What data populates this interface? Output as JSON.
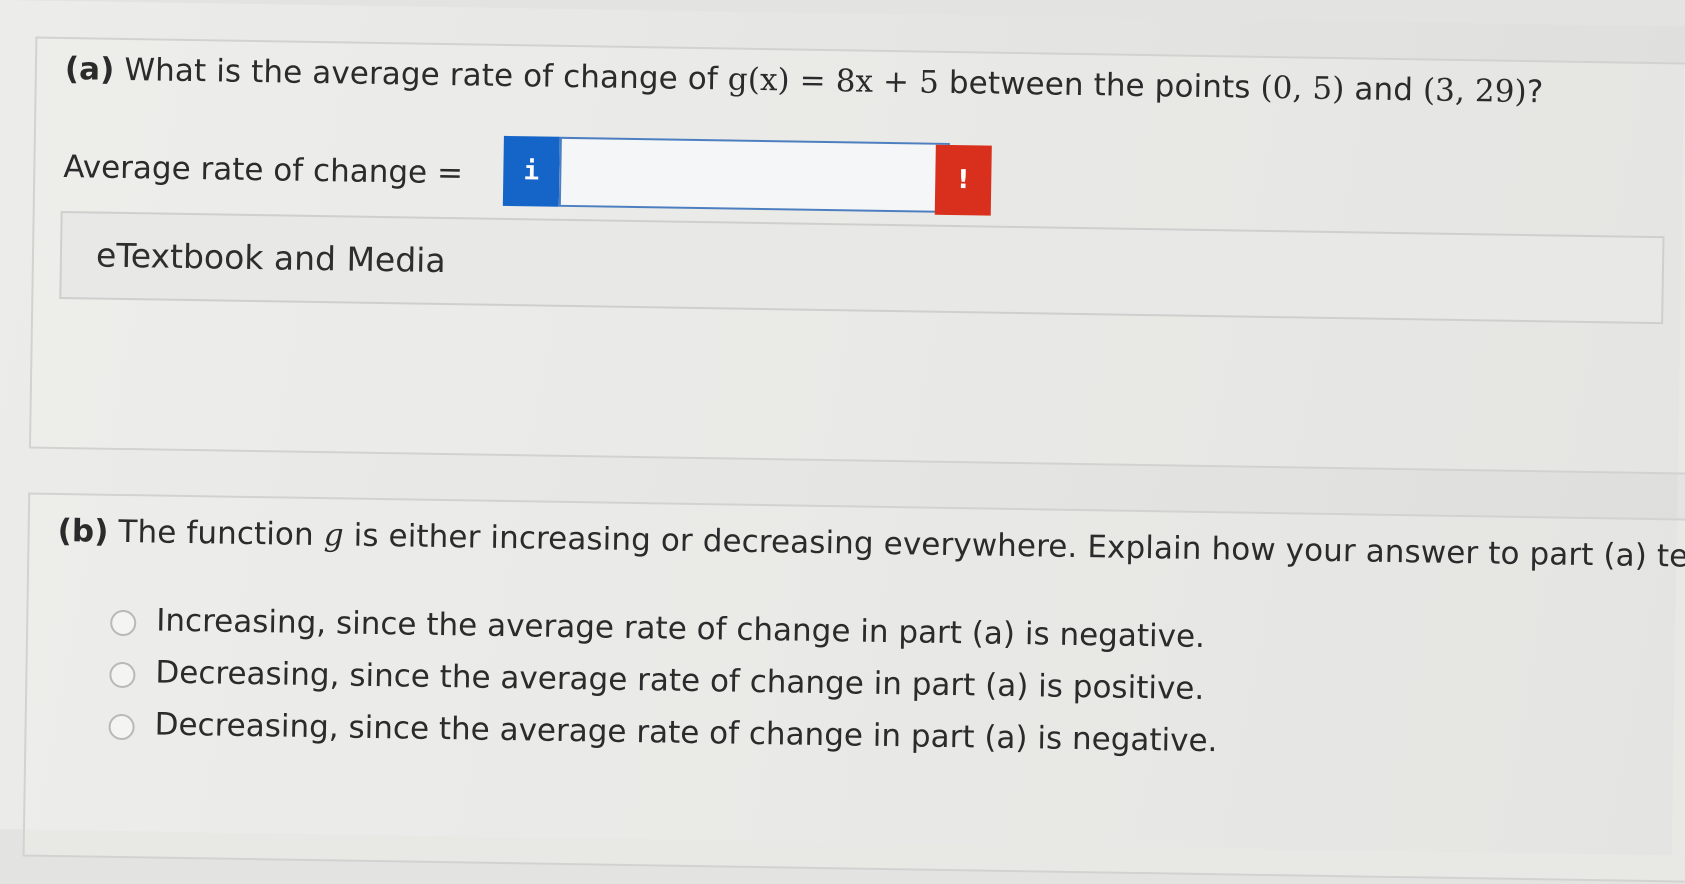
{
  "part_a": {
    "label": "(a)",
    "prefix": "What is the average rate of change of",
    "function": "g(x) = 8x + 5",
    "middle": "between the points",
    "point1": "(0, 5)",
    "and": "and",
    "point2": "(3, 29)",
    "suffix": "?",
    "answer_label": "Average rate of change =",
    "answer_value": "",
    "info_button": "i",
    "alert_button": "!",
    "etextbook": "eTextbook and Media"
  },
  "part_b": {
    "label": "(b)",
    "prefix": "The function",
    "var": "g",
    "text": "is either increasing or decreasing everywhere. Explain how your answer to part (a) tells yo",
    "options": [
      "Increasing, since the average rate of change in part (a) is negative.",
      "Decreasing, since the average rate of change in part (a) is positive.",
      "Decreasing, since the average rate of change in part (a) is negative."
    ]
  },
  "colors": {
    "info": "#1565c8",
    "alert": "#d9301d",
    "input_border": "#4d7fc0"
  }
}
